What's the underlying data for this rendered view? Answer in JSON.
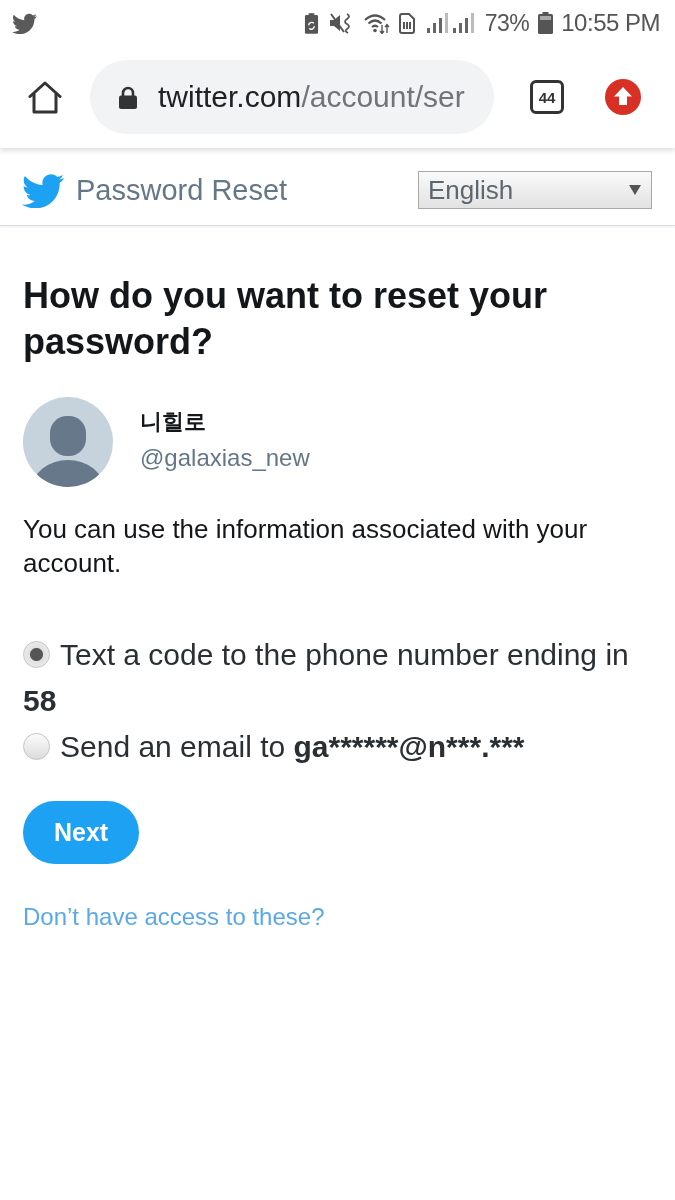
{
  "status_bar": {
    "battery": "73%",
    "time": "10:55 PM"
  },
  "browser": {
    "url_host": "twitter.com",
    "url_path": "/account/ser",
    "tab_count": "44"
  },
  "header": {
    "title": "Password Reset",
    "language": "English"
  },
  "heading": "How do you want to reset your password?",
  "account": {
    "name": "니힐로",
    "handle": "@galaxias_new"
  },
  "description": "You can use the information associated with your account.",
  "options": [
    {
      "text": "Text a code to the phone number ending in",
      "detail": "58",
      "selected": true
    },
    {
      "text": "Send an email to",
      "detail": "ga******@n***.***",
      "selected": false
    }
  ],
  "next_button": "Next",
  "help_link": "Don’t have access to these?"
}
